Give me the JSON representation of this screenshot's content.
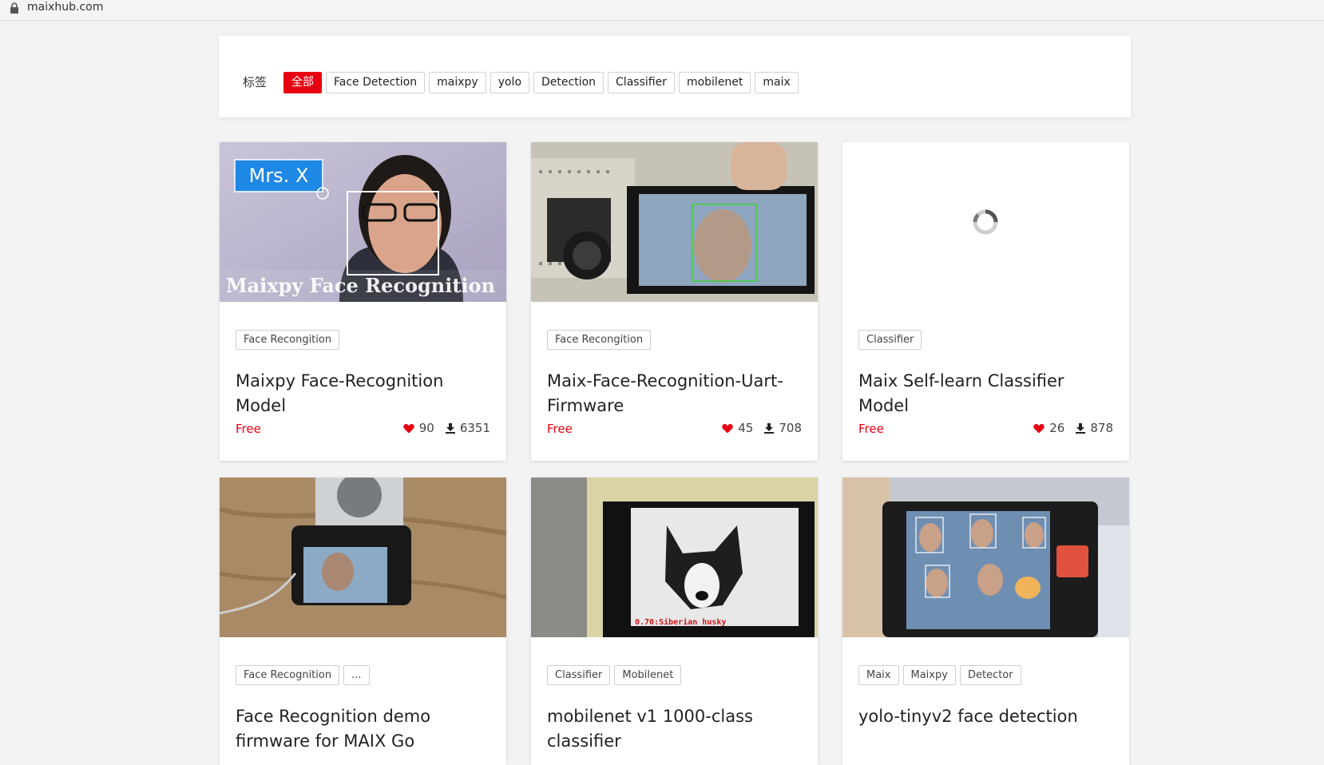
{
  "browser": {
    "url": "maixhub.com"
  },
  "filters": {
    "label": "标签",
    "items": [
      {
        "label": "全部",
        "active": true
      },
      {
        "label": "Face Detection"
      },
      {
        "label": "maixpy"
      },
      {
        "label": "yolo"
      },
      {
        "label": "Detection"
      },
      {
        "label": "Classifier"
      },
      {
        "label": "mobilenet"
      },
      {
        "label": "maix"
      }
    ]
  },
  "cards": [
    {
      "tags": [
        "Face Recongition"
      ],
      "title": "Maixpy Face-Recognition Model",
      "price": "Free",
      "likes": "90",
      "downloads": "6351",
      "thumb": {
        "box_label": "Mrs. X",
        "caption": "Maixpy Face Recognition"
      }
    },
    {
      "tags": [
        "Face Recongition"
      ],
      "title": "Maix-Face-Recognition-Uart-Firmware",
      "price": "Free",
      "likes": "45",
      "downloads": "708"
    },
    {
      "tags": [
        "Classifier"
      ],
      "title": "Maix Self-learn Classifier Model",
      "price": "Free",
      "likes": "26",
      "downloads": "878"
    },
    {
      "tags": [
        "Face Recognition",
        "..."
      ],
      "title": "Face Recognition demo firmware for MAIX Go"
    },
    {
      "tags": [
        "Classifier",
        "Mobilenet"
      ],
      "title": "mobilenet v1 1000-class classifier",
      "thumb": {
        "overlay": "0.70:Siberian husky"
      }
    },
    {
      "tags": [
        "Maix",
        "Maixpy",
        "Detector"
      ],
      "title": "yolo-tinyv2 face detection"
    }
  ],
  "colors": {
    "accent": "#e60012",
    "page_bg": "#f3f3f3"
  }
}
